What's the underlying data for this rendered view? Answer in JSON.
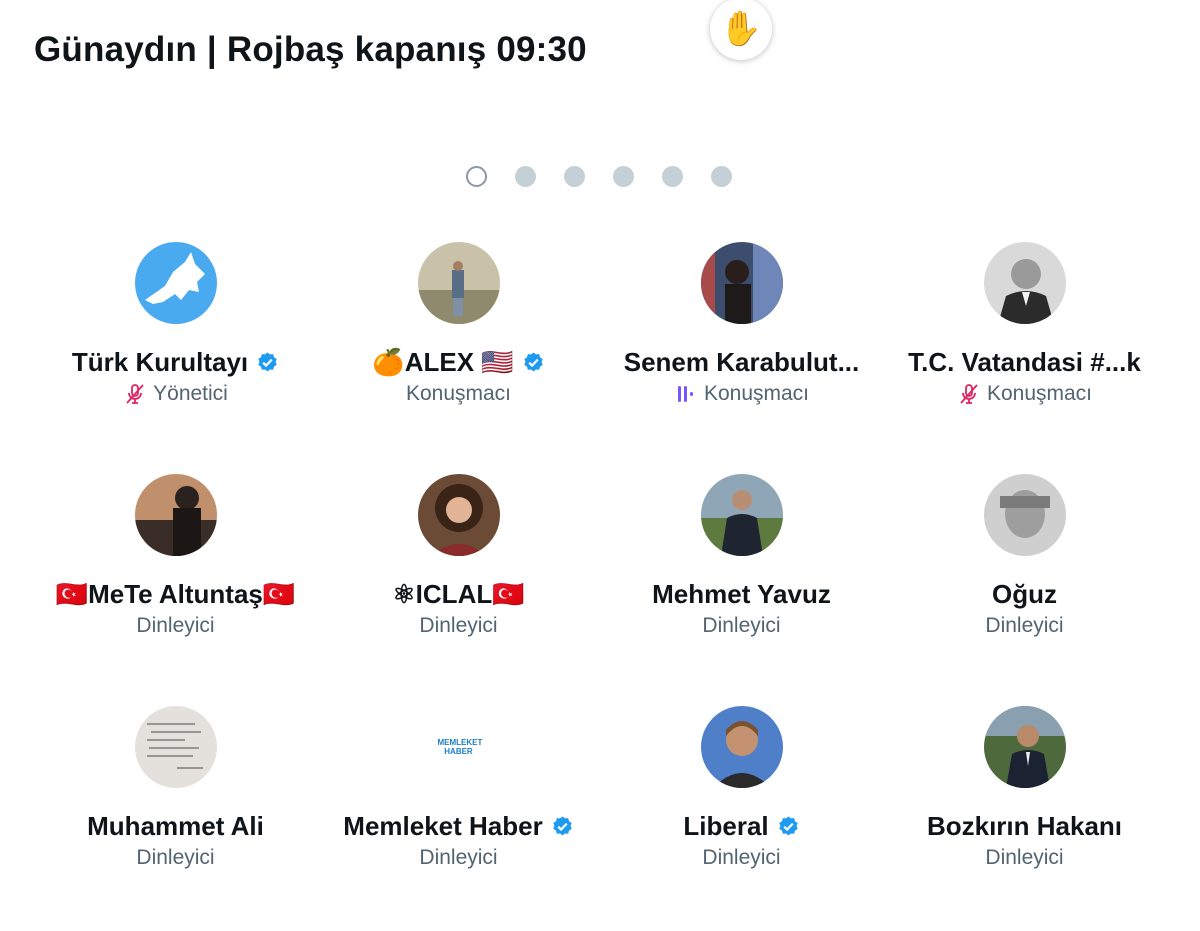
{
  "space": {
    "title": "Günaydın | Rojbaş kapanış 09:30"
  },
  "pager": {
    "count": 6,
    "active_index": 0
  },
  "colors": {
    "verified": "#1d9bf0",
    "muted": "#e0245e",
    "speaking": "#7856ff",
    "secondary_text": "#536471"
  },
  "participants": [
    {
      "name": "Türk Kurultayı",
      "verified": true,
      "role": "Yönetici",
      "status_icon": "mic-muted-icon"
    },
    {
      "name": "🍊ALEX 🇺🇸",
      "verified": true,
      "role": "Konuşmacı",
      "status_icon": ""
    },
    {
      "name": "Senem Karabulut...",
      "verified": false,
      "role": "Konuşmacı",
      "status_icon": "speaking-icon",
      "reaction": "✋",
      "reaction_icon": "raised-hand-icon"
    },
    {
      "name": "T.C. Vatandasi #...k",
      "verified": false,
      "role": "Konuşmacı",
      "status_icon": "mic-muted-icon"
    },
    {
      "name": "🇹🇷MeTe Altuntaş🇹🇷",
      "verified": false,
      "role": "Dinleyici",
      "status_icon": ""
    },
    {
      "name": "⚛ICLAL🇹🇷",
      "verified": false,
      "role": "Dinleyici",
      "status_icon": ""
    },
    {
      "name": "Mehmet Yavuz",
      "verified": false,
      "role": "Dinleyici",
      "status_icon": ""
    },
    {
      "name": "Oğuz",
      "verified": false,
      "role": "Dinleyici",
      "status_icon": ""
    },
    {
      "name": "Muhammet Ali",
      "verified": false,
      "role": "Dinleyici",
      "status_icon": ""
    },
    {
      "name": "Memleket Haber",
      "verified": true,
      "role": "Dinleyici",
      "status_icon": "",
      "avatar_text": "MEMLEKET HABER"
    },
    {
      "name": "Liberal",
      "verified": true,
      "role": "Dinleyici",
      "status_icon": ""
    },
    {
      "name": "Bozkırın Hakanı",
      "verified": false,
      "role": "Dinleyici",
      "status_icon": ""
    }
  ]
}
